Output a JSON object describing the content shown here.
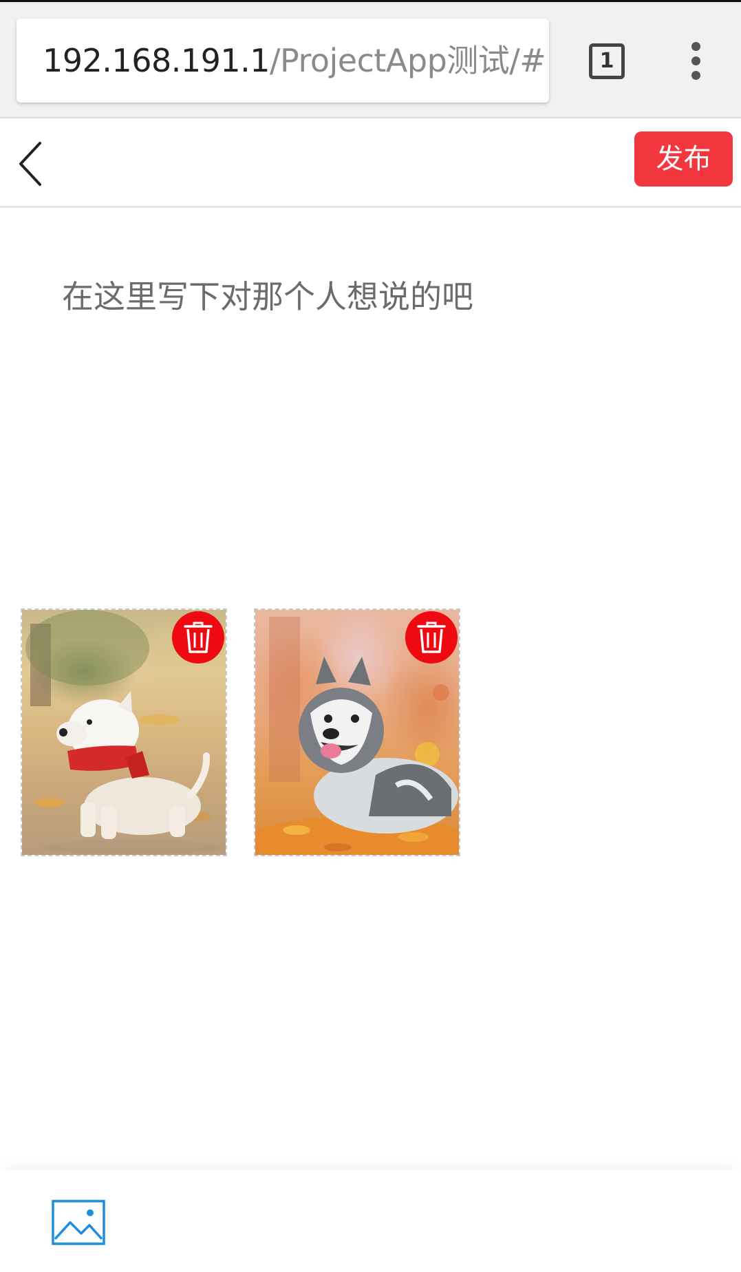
{
  "browser": {
    "url_host": "192.168.191.1",
    "url_path": "/ProjectApp测试/#",
    "tab_count": "1"
  },
  "header": {
    "publish_label": "发布"
  },
  "compose": {
    "placeholder": "在这里写下对那个人想说的吧"
  },
  "photos": [
    {
      "subject": "white terrier dog wearing red scarf",
      "delete_icon": "trash-icon"
    },
    {
      "subject": "husky dog lying in autumn leaves",
      "delete_icon": "trash-icon"
    }
  ],
  "toolbar": {
    "image_icon": "image-icon"
  },
  "colors": {
    "accent": "#f2373f",
    "delete": "#ee0a10",
    "image_icon": "#1a8ee0"
  }
}
